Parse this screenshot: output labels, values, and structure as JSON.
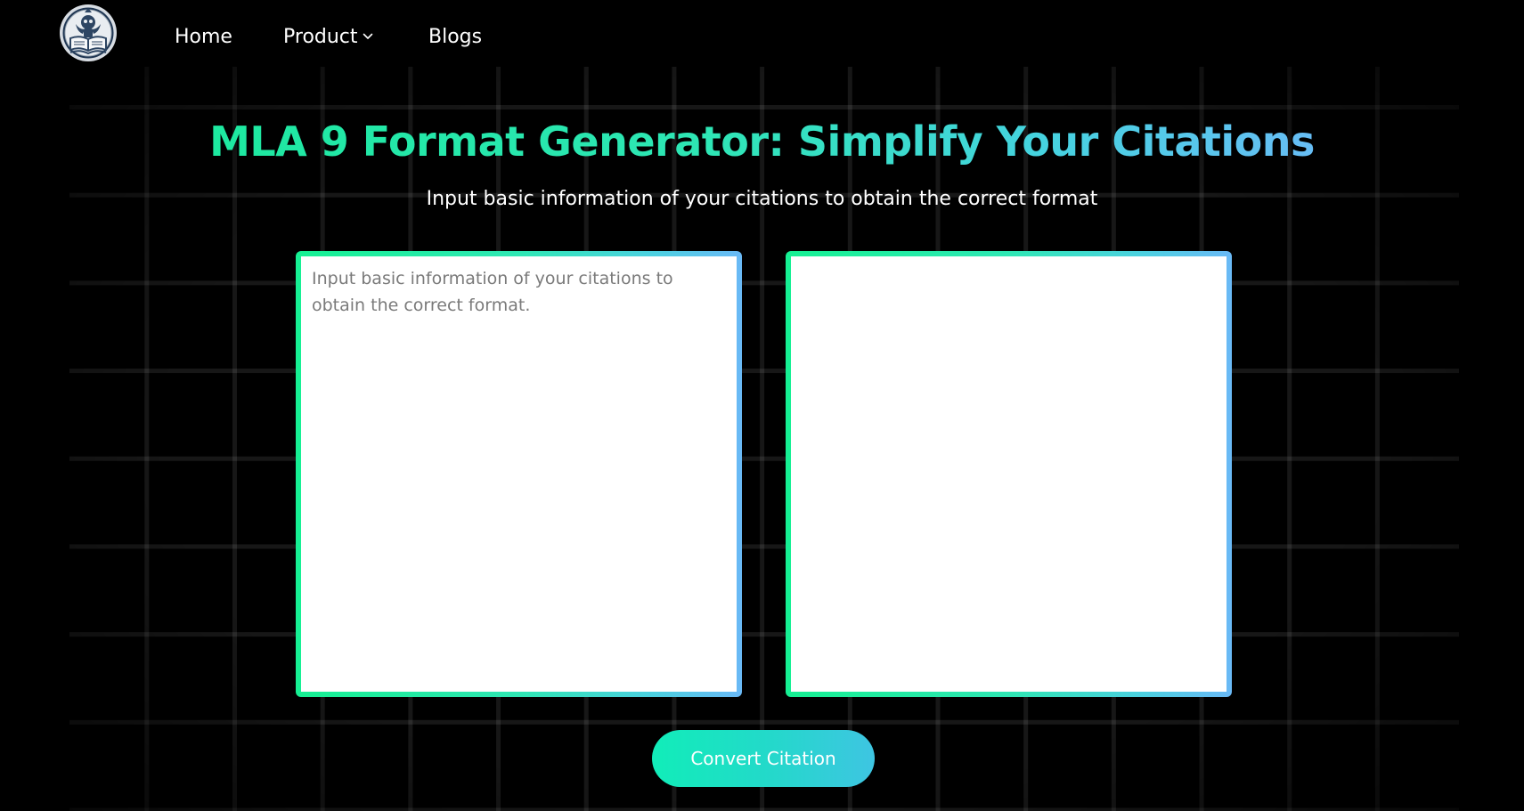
{
  "header": {
    "logo_alt": "Logo",
    "nav": {
      "home_label": "Home",
      "product_label": "Product",
      "blogs_label": "Blogs"
    }
  },
  "hero": {
    "title": "MLA 9 Format Generator: Simplify Your Citations",
    "subtitle": "Input basic information of your citations to obtain the correct format"
  },
  "input_box": {
    "placeholder": "Input basic information of your citations to obtain the correct format.",
    "value": ""
  },
  "output_box": {
    "value": ""
  },
  "convert_button": {
    "label": "Convert Citation"
  },
  "colors": {
    "background": "#000000",
    "accent_start": "#16f093",
    "accent_end": "#6ab9f6",
    "button_start": "#11edb9",
    "button_end": "#3ec5e2"
  }
}
